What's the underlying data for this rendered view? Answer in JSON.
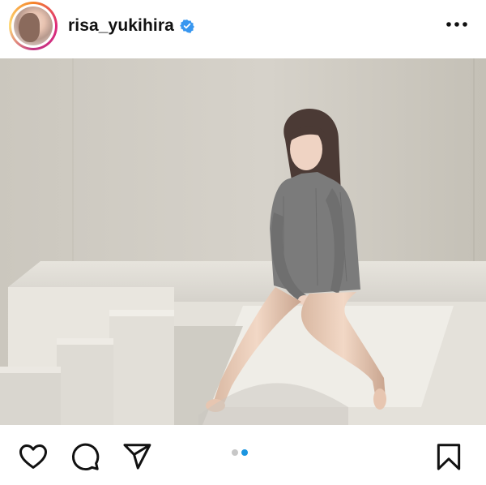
{
  "post": {
    "username": "risa_yukihira",
    "verified": true,
    "more_icon": "more-horizontal-icon",
    "media_count": 2,
    "active_media_index": 2
  },
  "actions": {
    "like_icon": "heart-icon",
    "comment_icon": "comment-icon",
    "share_icon": "send-icon",
    "save_icon": "bookmark-icon"
  },
  "colors": {
    "verified_badge": "#3897f0",
    "active_dot": "#1b95e0",
    "inactive_dot": "#c7c7c7",
    "text": "#111111"
  }
}
